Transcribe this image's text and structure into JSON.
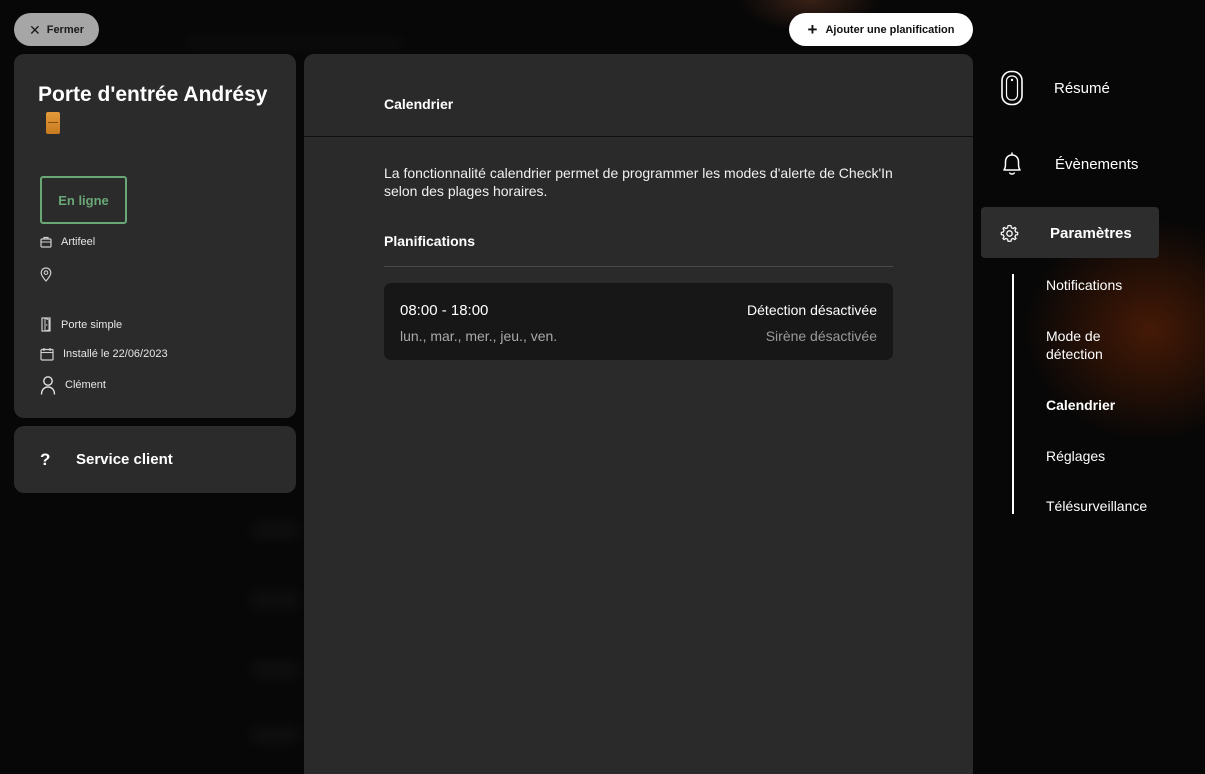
{
  "top_bar": {
    "close_label": "Fermer",
    "add_label": "Ajouter une planification"
  },
  "device": {
    "name": "Porte d'entrée Andrésy",
    "status": "En ligne",
    "owner_org": "Artifeel",
    "location": "",
    "door_type": "Porte simple",
    "installed": "Installé le 22/06/2023",
    "user": "Clément"
  },
  "service": {
    "icon": "?",
    "label": "Service client"
  },
  "main": {
    "title": "Calendrier",
    "description": "La fonctionnalité calendrier permet de programmer les modes d'alerte de Check'In selon des plages horaires.",
    "section_title": "Planifications",
    "schedules": [
      {
        "time": "08:00 - 18:00",
        "days": "lun., mar., mer., jeu., ven.",
        "detection": "Détection désactivée",
        "siren": "Sirène désactivée"
      }
    ]
  },
  "nav": {
    "items": [
      {
        "label": "Résumé",
        "icon": "device-icon"
      },
      {
        "label": "Évènements",
        "icon": "bell-icon"
      },
      {
        "label": "Paramètres",
        "icon": "gear-icon"
      }
    ],
    "sub_items": [
      {
        "label": "Notifications"
      },
      {
        "label": "Mode de détection"
      },
      {
        "label": "Calendrier"
      },
      {
        "label": "Réglages"
      },
      {
        "label": "Télésurveillance"
      }
    ]
  },
  "colors": {
    "status_green": "#6aa776",
    "panel": "#2a2a2a",
    "card": "#171717"
  }
}
